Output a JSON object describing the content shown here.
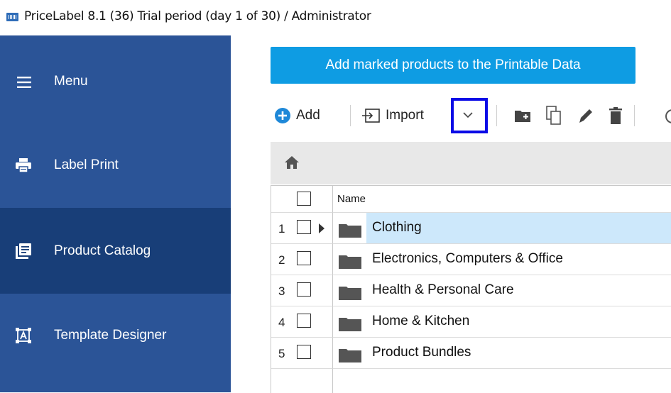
{
  "window": {
    "title": "PriceLabel 8.1 (36) Trial period (day 1 of 30) / Administrator"
  },
  "sidebar": {
    "menu_label": "Menu",
    "items": [
      {
        "label": "Label Print",
        "icon": "printer-icon"
      },
      {
        "label": "Product Catalog",
        "icon": "catalog-icon",
        "active": true
      },
      {
        "label": "Template Designer",
        "icon": "template-icon"
      }
    ]
  },
  "main": {
    "add_marked_label": "Add marked products to the Printable Data",
    "toolbar": {
      "add_label": "Add",
      "import_label": "Import"
    },
    "grid": {
      "header": {
        "name": "Name"
      },
      "rows": [
        {
          "index": "1",
          "name": "Clothing",
          "selected": true
        },
        {
          "index": "2",
          "name": "Electronics, Computers & Office"
        },
        {
          "index": "3",
          "name": "Health & Personal Care"
        },
        {
          "index": "4",
          "name": "Home & Kitchen"
        },
        {
          "index": "5",
          "name": "Product Bundles"
        }
      ]
    }
  },
  "colors": {
    "sidebar": "#2b5497",
    "sidebar_active": "#183e78",
    "accent_button": "#0e9ce3",
    "selection": "#cde8fb",
    "highlight_box": "#0a0ae6"
  }
}
